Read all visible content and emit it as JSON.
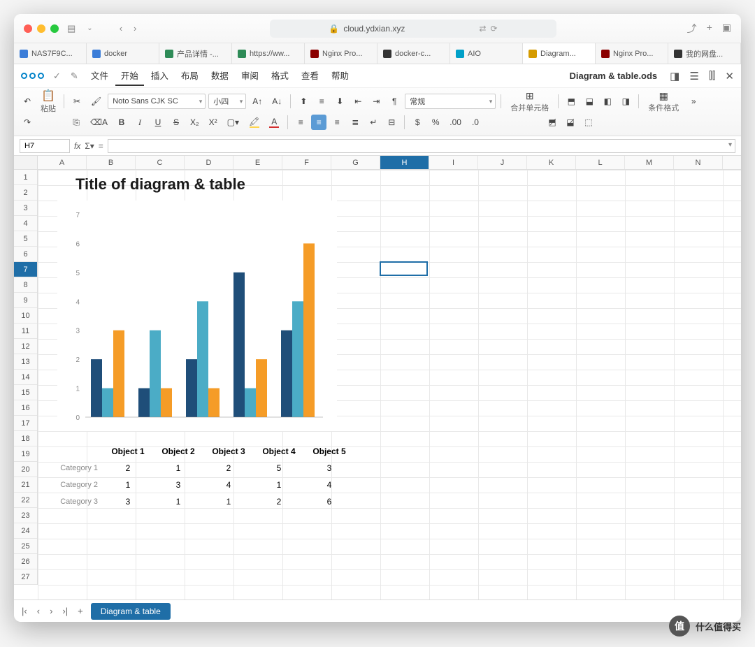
{
  "browser": {
    "url": "cloud.ydxian.xyz",
    "tabs": [
      {
        "label": "NAS7F9C...",
        "color": "#3b7dd8"
      },
      {
        "label": "docker",
        "color": "#3b7dd8"
      },
      {
        "label": "产品详情 -...",
        "color": "#2e8b57"
      },
      {
        "label": "https://ww...",
        "color": "#2e8b57"
      },
      {
        "label": "Nginx Pro...",
        "color": "#8b0000"
      },
      {
        "label": "docker-c...",
        "color": "#333"
      },
      {
        "label": "AIO",
        "color": "#00a0c8"
      },
      {
        "label": "Diagram...",
        "color": "#d59b00",
        "active": true
      },
      {
        "label": "Nginx Pro...",
        "color": "#8b0000"
      },
      {
        "label": "我的网盘...",
        "color": "#333"
      }
    ]
  },
  "menubar": {
    "items": [
      "文件",
      "开始",
      "插入",
      "布局",
      "数据",
      "审阅",
      "格式",
      "查看",
      "帮助"
    ],
    "active": 1,
    "doc_title": "Diagram & table.ods"
  },
  "toolbar": {
    "paste_label": "粘贴",
    "font_name": "Noto Sans CJK SC",
    "font_size": "小四",
    "style_select": "常规",
    "merge_label": "合并单元格",
    "cond_format_label": "条件格式"
  },
  "formula": {
    "cellref": "H7"
  },
  "columns": [
    "A",
    "B",
    "C",
    "D",
    "E",
    "F",
    "G",
    "H",
    "I",
    "J",
    "K",
    "L",
    "M",
    "N"
  ],
  "selected_col_index": 7,
  "selected_row_index": 6,
  "selected_cell": {
    "col": 7,
    "row": 6
  },
  "row_count": 27,
  "chart_data": {
    "type": "bar",
    "title": "Title of diagram & table",
    "categories": [
      "Object 1",
      "Object 2",
      "Object 3",
      "Object 4",
      "Object 5"
    ],
    "series": [
      {
        "name": "Category 1",
        "color": "#1f4e79",
        "values": [
          2,
          1,
          2,
          5,
          3
        ]
      },
      {
        "name": "Category 2",
        "color": "#4bacc6",
        "values": [
          1,
          3,
          4,
          1,
          4
        ]
      },
      {
        "name": "Category 3",
        "color": "#f59c27",
        "values": [
          3,
          1,
          1,
          2,
          6
        ]
      }
    ],
    "ylim": [
      0,
      7
    ],
    "ylabel": "",
    "xlabel": "",
    "grid": false
  },
  "table": {
    "headers": [
      "Object 1",
      "Object 2",
      "Object 3",
      "Object 4",
      "Object 5"
    ],
    "rows": [
      {
        "label": "Category 1",
        "cells": [
          2,
          1,
          2,
          5,
          3
        ]
      },
      {
        "label": "Category 2",
        "cells": [
          1,
          3,
          4,
          1,
          4
        ]
      },
      {
        "label": "Category 3",
        "cells": [
          3,
          1,
          1,
          2,
          6
        ]
      }
    ]
  },
  "sheet_tab": "Diagram & table",
  "watermark": "什么值得买"
}
